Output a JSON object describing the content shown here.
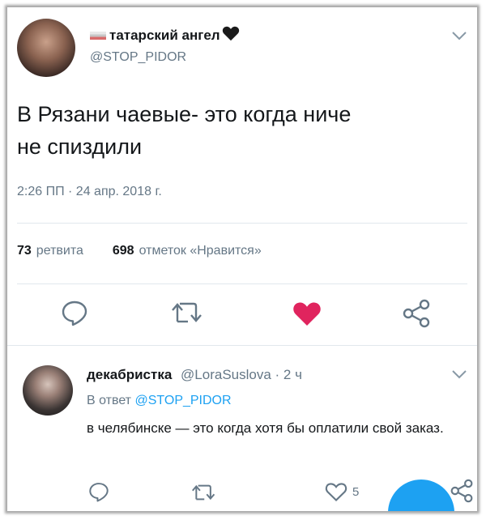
{
  "tweet": {
    "display_name": "татарский ангел",
    "handle": "@STOP_PIDOR",
    "text_line1": "В Рязани чаевые- это когда ниче",
    "text_line2": "не спиздили",
    "timestamp": "2:26 ПП · 24 апр. 2018 г.",
    "retweet_count": "73",
    "retweet_label": "ретвита",
    "like_count": "698",
    "like_label": "отметок «Нравится»",
    "liked": true
  },
  "reply": {
    "display_name": "декабристка",
    "handle": "@LoraSuslova",
    "time": "· 2 ч",
    "reply_prefix": "В ответ",
    "reply_to": "@STOP_PIDOR",
    "text": "в челябинске — это когда хотя бы оплатили свой заказ.",
    "like_count": "5"
  },
  "colors": {
    "accent": "#1da1f2",
    "like": "#e0245e",
    "muted": "#657786"
  }
}
